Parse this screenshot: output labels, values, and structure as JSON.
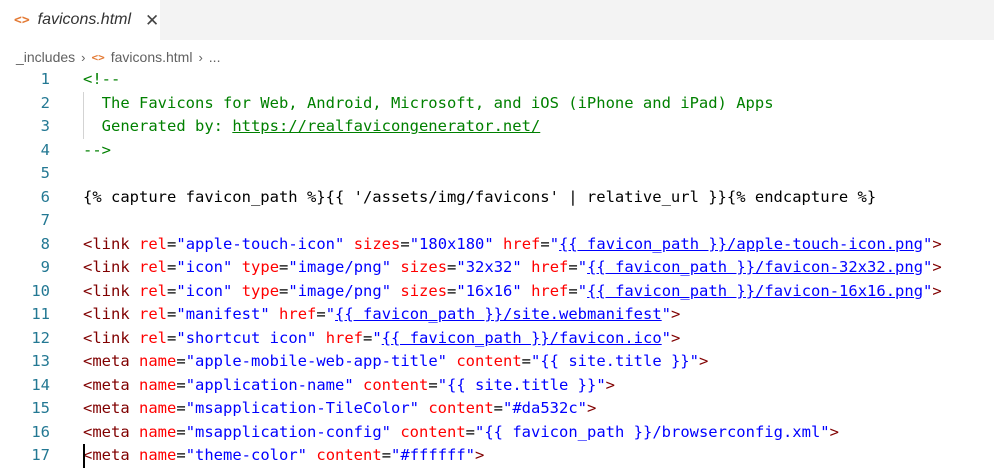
{
  "tab": {
    "label": "favicons.html",
    "icon": "html-file-icon",
    "close_glyph": "✕"
  },
  "breadcrumb": {
    "items": [
      "_includes",
      "favicons.html",
      "..."
    ],
    "separator": "›"
  },
  "colors": {
    "comment": "#008000",
    "tag": "#800000",
    "attribute": "#ff0000",
    "value": "#0000ff",
    "line_number": "#237893",
    "file_icon": "#e37933"
  },
  "editor": {
    "lines": [
      {
        "n": "1",
        "tokens": [
          {
            "t": "<!--",
            "c": "comment"
          }
        ]
      },
      {
        "n": "2",
        "guide": true,
        "tokens": [
          {
            "t": "  The Favicons for Web, Android, Microsoft, and iOS (iPhone and iPad) Apps",
            "c": "comment"
          }
        ]
      },
      {
        "n": "3",
        "guide": true,
        "tokens": [
          {
            "t": "  Generated by: ",
            "c": "comment"
          },
          {
            "t": "https://realfavicongenerator.net/",
            "c": "link"
          }
        ]
      },
      {
        "n": "4",
        "tokens": [
          {
            "t": "-->",
            "c": "comment"
          }
        ]
      },
      {
        "n": "5",
        "tokens": []
      },
      {
        "n": "6",
        "tokens": [
          {
            "t": "{% capture favicon_path %}{{ '/assets/img/favicons' | relative_url }}{% endcapture %}",
            "c": "plain"
          }
        ]
      },
      {
        "n": "7",
        "tokens": []
      },
      {
        "n": "8",
        "tokens": [
          {
            "t": "<link",
            "c": "tag"
          },
          {
            "t": " ",
            "c": "plain"
          },
          {
            "t": "rel",
            "c": "attr"
          },
          {
            "t": "=",
            "c": "plain"
          },
          {
            "t": "\"apple-touch-icon\"",
            "c": "val"
          },
          {
            "t": " ",
            "c": "plain"
          },
          {
            "t": "sizes",
            "c": "attr"
          },
          {
            "t": "=",
            "c": "plain"
          },
          {
            "t": "\"180x180\"",
            "c": "val"
          },
          {
            "t": " ",
            "c": "plain"
          },
          {
            "t": "href",
            "c": "attr"
          },
          {
            "t": "=",
            "c": "plain"
          },
          {
            "t": "\"",
            "c": "val"
          },
          {
            "t": "{{ favicon_path }}/apple-touch-icon.png",
            "c": "tpl"
          },
          {
            "t": "\"",
            "c": "val"
          },
          {
            "t": ">",
            "c": "tag"
          }
        ]
      },
      {
        "n": "9",
        "tokens": [
          {
            "t": "<link",
            "c": "tag"
          },
          {
            "t": " ",
            "c": "plain"
          },
          {
            "t": "rel",
            "c": "attr"
          },
          {
            "t": "=",
            "c": "plain"
          },
          {
            "t": "\"icon\"",
            "c": "val"
          },
          {
            "t": " ",
            "c": "plain"
          },
          {
            "t": "type",
            "c": "attr"
          },
          {
            "t": "=",
            "c": "plain"
          },
          {
            "t": "\"image/png\"",
            "c": "val"
          },
          {
            "t": " ",
            "c": "plain"
          },
          {
            "t": "sizes",
            "c": "attr"
          },
          {
            "t": "=",
            "c": "plain"
          },
          {
            "t": "\"32x32\"",
            "c": "val"
          },
          {
            "t": " ",
            "c": "plain"
          },
          {
            "t": "href",
            "c": "attr"
          },
          {
            "t": "=",
            "c": "plain"
          },
          {
            "t": "\"",
            "c": "val"
          },
          {
            "t": "{{ favicon_path }}/favicon-32x32.png",
            "c": "tpl"
          },
          {
            "t": "\"",
            "c": "val"
          },
          {
            "t": ">",
            "c": "tag"
          }
        ]
      },
      {
        "n": "10",
        "tokens": [
          {
            "t": "<link",
            "c": "tag"
          },
          {
            "t": " ",
            "c": "plain"
          },
          {
            "t": "rel",
            "c": "attr"
          },
          {
            "t": "=",
            "c": "plain"
          },
          {
            "t": "\"icon\"",
            "c": "val"
          },
          {
            "t": " ",
            "c": "plain"
          },
          {
            "t": "type",
            "c": "attr"
          },
          {
            "t": "=",
            "c": "plain"
          },
          {
            "t": "\"image/png\"",
            "c": "val"
          },
          {
            "t": " ",
            "c": "plain"
          },
          {
            "t": "sizes",
            "c": "attr"
          },
          {
            "t": "=",
            "c": "plain"
          },
          {
            "t": "\"16x16\"",
            "c": "val"
          },
          {
            "t": " ",
            "c": "plain"
          },
          {
            "t": "href",
            "c": "attr"
          },
          {
            "t": "=",
            "c": "plain"
          },
          {
            "t": "\"",
            "c": "val"
          },
          {
            "t": "{{ favicon_path }}/favicon-16x16.png",
            "c": "tpl"
          },
          {
            "t": "\"",
            "c": "val"
          },
          {
            "t": ">",
            "c": "tag"
          }
        ]
      },
      {
        "n": "11",
        "tokens": [
          {
            "t": "<link",
            "c": "tag"
          },
          {
            "t": " ",
            "c": "plain"
          },
          {
            "t": "rel",
            "c": "attr"
          },
          {
            "t": "=",
            "c": "plain"
          },
          {
            "t": "\"manifest\"",
            "c": "val"
          },
          {
            "t": " ",
            "c": "plain"
          },
          {
            "t": "href",
            "c": "attr"
          },
          {
            "t": "=",
            "c": "plain"
          },
          {
            "t": "\"",
            "c": "val"
          },
          {
            "t": "{{ favicon_path }}/site.webmanifest",
            "c": "tpl"
          },
          {
            "t": "\"",
            "c": "val"
          },
          {
            "t": ">",
            "c": "tag"
          }
        ]
      },
      {
        "n": "12",
        "tokens": [
          {
            "t": "<link",
            "c": "tag"
          },
          {
            "t": " ",
            "c": "plain"
          },
          {
            "t": "rel",
            "c": "attr"
          },
          {
            "t": "=",
            "c": "plain"
          },
          {
            "t": "\"shortcut icon\"",
            "c": "val"
          },
          {
            "t": " ",
            "c": "plain"
          },
          {
            "t": "href",
            "c": "attr"
          },
          {
            "t": "=",
            "c": "plain"
          },
          {
            "t": "\"",
            "c": "val"
          },
          {
            "t": "{{ favicon_path }}/favicon.ico",
            "c": "tpl"
          },
          {
            "t": "\"",
            "c": "val"
          },
          {
            "t": ">",
            "c": "tag"
          }
        ]
      },
      {
        "n": "13",
        "tokens": [
          {
            "t": "<meta",
            "c": "tag"
          },
          {
            "t": " ",
            "c": "plain"
          },
          {
            "t": "name",
            "c": "attr"
          },
          {
            "t": "=",
            "c": "plain"
          },
          {
            "t": "\"apple-mobile-web-app-title\"",
            "c": "val"
          },
          {
            "t": " ",
            "c": "plain"
          },
          {
            "t": "content",
            "c": "attr"
          },
          {
            "t": "=",
            "c": "plain"
          },
          {
            "t": "\"{{ site.title }}\"",
            "c": "val"
          },
          {
            "t": ">",
            "c": "tag"
          }
        ]
      },
      {
        "n": "14",
        "tokens": [
          {
            "t": "<meta",
            "c": "tag"
          },
          {
            "t": " ",
            "c": "plain"
          },
          {
            "t": "name",
            "c": "attr"
          },
          {
            "t": "=",
            "c": "plain"
          },
          {
            "t": "\"application-name\"",
            "c": "val"
          },
          {
            "t": " ",
            "c": "plain"
          },
          {
            "t": "content",
            "c": "attr"
          },
          {
            "t": "=",
            "c": "plain"
          },
          {
            "t": "\"{{ site.title }}\"",
            "c": "val"
          },
          {
            "t": ">",
            "c": "tag"
          }
        ]
      },
      {
        "n": "15",
        "tokens": [
          {
            "t": "<meta",
            "c": "tag"
          },
          {
            "t": " ",
            "c": "plain"
          },
          {
            "t": "name",
            "c": "attr"
          },
          {
            "t": "=",
            "c": "plain"
          },
          {
            "t": "\"msapplication-TileColor\"",
            "c": "val"
          },
          {
            "t": " ",
            "c": "plain"
          },
          {
            "t": "content",
            "c": "attr"
          },
          {
            "t": "=",
            "c": "plain"
          },
          {
            "t": "\"#da532c\"",
            "c": "val"
          },
          {
            "t": ">",
            "c": "tag"
          }
        ]
      },
      {
        "n": "16",
        "tokens": [
          {
            "t": "<meta",
            "c": "tag"
          },
          {
            "t": " ",
            "c": "plain"
          },
          {
            "t": "name",
            "c": "attr"
          },
          {
            "t": "=",
            "c": "plain"
          },
          {
            "t": "\"msapplication-config\"",
            "c": "val"
          },
          {
            "t": " ",
            "c": "plain"
          },
          {
            "t": "content",
            "c": "attr"
          },
          {
            "t": "=",
            "c": "plain"
          },
          {
            "t": "\"{{ favicon_path }}/browserconfig.xml\"",
            "c": "val"
          },
          {
            "t": ">",
            "c": "tag"
          }
        ]
      },
      {
        "n": "17",
        "cursor": true,
        "tokens": [
          {
            "t": "<meta",
            "c": "tag"
          },
          {
            "t": " ",
            "c": "plain"
          },
          {
            "t": "name",
            "c": "attr"
          },
          {
            "t": "=",
            "c": "plain"
          },
          {
            "t": "\"theme-color\"",
            "c": "val"
          },
          {
            "t": " ",
            "c": "plain"
          },
          {
            "t": "content",
            "c": "attr"
          },
          {
            "t": "=",
            "c": "plain"
          },
          {
            "t": "\"#ffffff\"",
            "c": "val"
          },
          {
            "t": ">",
            "c": "tag"
          }
        ]
      }
    ]
  }
}
